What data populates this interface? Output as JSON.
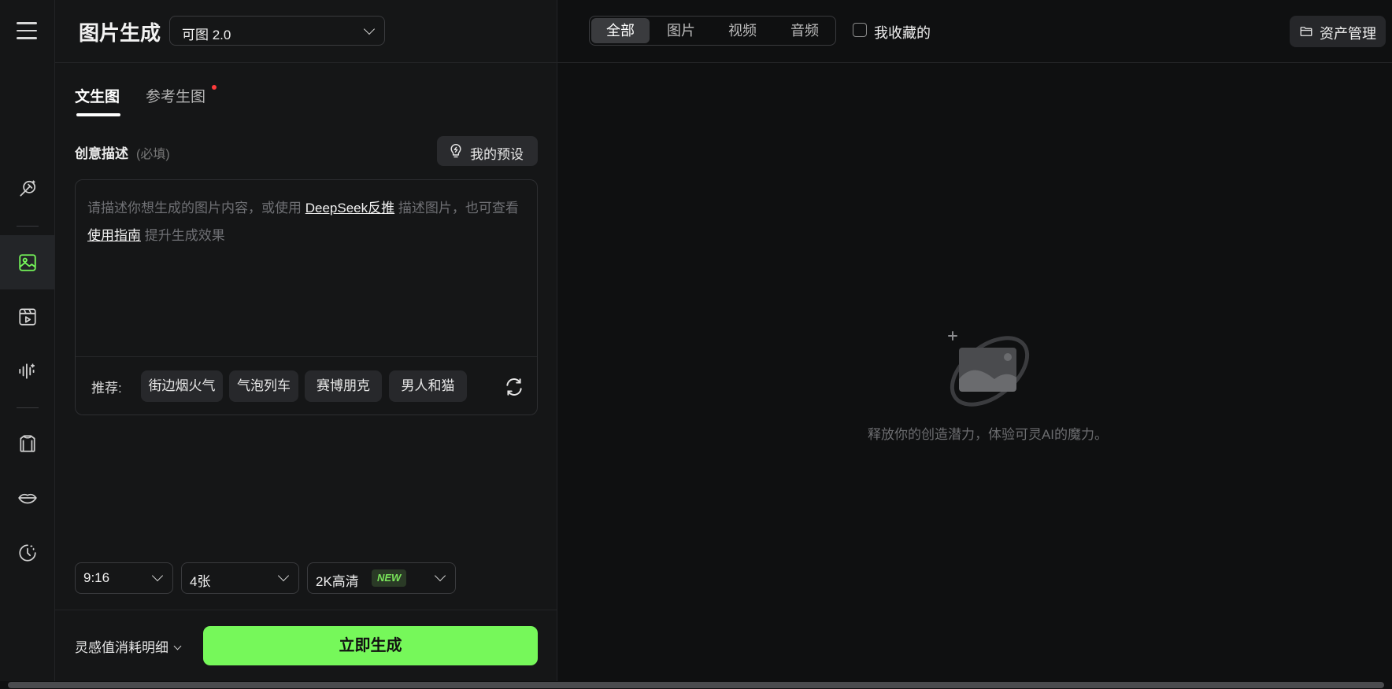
{
  "rail": {
    "items": [
      {
        "icon": "magic-wand-icon"
      },
      {
        "icon": "image-icon",
        "active": true
      },
      {
        "icon": "video-icon"
      },
      {
        "icon": "audio-wave-icon"
      },
      {
        "icon": "shirt-icon"
      },
      {
        "icon": "lips-icon"
      },
      {
        "icon": "history-icon"
      }
    ]
  },
  "header": {
    "title": "图片生成",
    "model": "可图 2.0"
  },
  "tabs": {
    "text2img": "文生图",
    "ref2img": "参考生图"
  },
  "prompt": {
    "label": "创意描述",
    "required": "(必填)",
    "preset_button": "我的预设",
    "placeholder_1": "请描述你想生成的图片内容，或使用 ",
    "link_deepseek": "DeepSeek反推",
    "placeholder_2": " 描述图片，也可查看 ",
    "link_guide": "使用指南",
    "placeholder_3": " 提升生成效果",
    "recommend_label": "推荐:",
    "chips": [
      "街边烟火气",
      "气泡列车",
      "赛博朋克",
      "男人和猫"
    ]
  },
  "options": {
    "ratio": "9:16",
    "count": "4张",
    "quality": "2K高清",
    "quality_badge": "NEW"
  },
  "footer": {
    "cost_link": "灵感值消耗明细",
    "generate": "立即生成"
  },
  "right": {
    "filters": [
      "全部",
      "图片",
      "视频",
      "音频"
    ],
    "active_filter": "全部",
    "favorites": "我收藏的",
    "asset_button": "资产管理",
    "empty_message": "释放你的创造潜力，体验可灵AI的魔力。"
  },
  "colors": {
    "accent": "#76f85a",
    "background": "#0f1011",
    "panel": "#151617"
  }
}
